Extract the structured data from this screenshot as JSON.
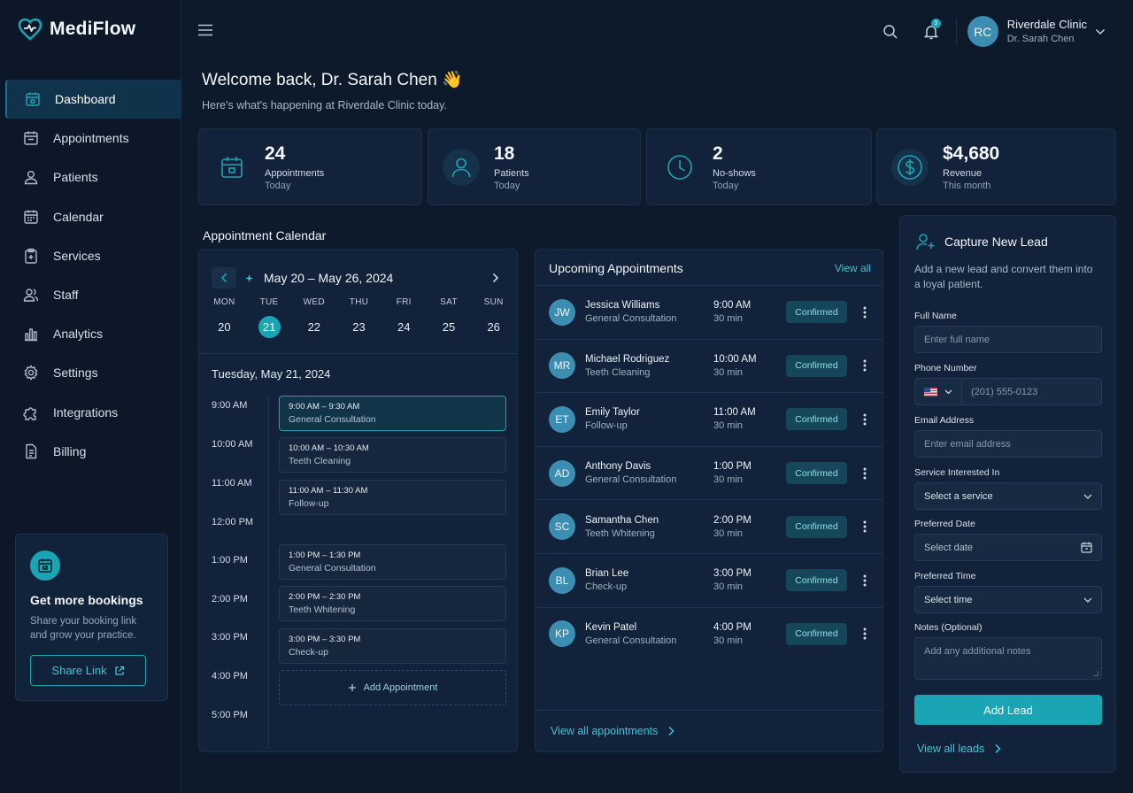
{
  "app": {
    "name": "MediFlow"
  },
  "sidebar": {
    "items": [
      {
        "label": "Dashboard",
        "icon": "dashboard-icon",
        "active": true
      },
      {
        "label": "Appointments",
        "icon": "appointments-icon"
      },
      {
        "label": "Patients",
        "icon": "patients-icon"
      },
      {
        "label": "Calendar",
        "icon": "calendar-icon"
      },
      {
        "label": "Services",
        "icon": "services-icon"
      },
      {
        "label": "Staff",
        "icon": "staff-icon"
      },
      {
        "label": "Analytics",
        "icon": "analytics-icon"
      },
      {
        "label": "Settings",
        "icon": "settings-icon"
      },
      {
        "label": "Integrations",
        "icon": "integrations-icon"
      },
      {
        "label": "Billing",
        "icon": "billing-icon"
      }
    ],
    "promo": {
      "title": "Get more bookings",
      "text": "Share your booking link and grow your practice.",
      "button": "Share Link"
    }
  },
  "header": {
    "notification_count": "3",
    "user": {
      "initials": "RC",
      "org": "Riverdale Clinic",
      "name": "Dr. Sarah Chen"
    }
  },
  "welcome": {
    "title": "Welcome back, Dr. Sarah Chen 👋",
    "subtitle": "Here's what's happening at Riverdale Clinic today."
  },
  "stats": [
    {
      "value": "24",
      "label": "Appointments",
      "sub": "Today",
      "icon": "calendar-icon"
    },
    {
      "value": "18",
      "label": "Patients",
      "sub": "Today",
      "icon": "user-icon"
    },
    {
      "value": "2",
      "label": "No-shows",
      "sub": "Today",
      "icon": "clock-icon"
    },
    {
      "value": "$4,680",
      "label": "Revenue",
      "sub": "This month",
      "icon": "dollar-icon"
    }
  ],
  "calendar": {
    "section_title": "Appointment Calendar",
    "range": "May 20 – May 26, 2024",
    "days": [
      {
        "name": "MON",
        "num": "20"
      },
      {
        "name": "TUE",
        "num": "21",
        "selected": true
      },
      {
        "name": "WED",
        "num": "22"
      },
      {
        "name": "THU",
        "num": "23"
      },
      {
        "name": "FRI",
        "num": "24"
      },
      {
        "name": "SAT",
        "num": "25"
      },
      {
        "name": "SUN",
        "num": "26"
      }
    ],
    "day_title": "Tuesday, May 21, 2024",
    "times": [
      "9:00 AM",
      "10:00 AM",
      "11:00 AM",
      "12:00 PM",
      "1:00 PM",
      "2:00 PM",
      "3:00 PM",
      "4:00 PM",
      "5:00 PM"
    ],
    "slots": [
      {
        "time": "9:00 AM – 9:30 AM",
        "type": "General Consultation"
      },
      {
        "time": "10:00 AM – 10:30 AM",
        "type": "Teeth Cleaning"
      },
      {
        "time": "11:00 AM – 11:30 AM",
        "type": "Follow-up"
      },
      {
        "time": "1:00 PM – 1:30 PM",
        "type": "General Consultation"
      },
      {
        "time": "2:00 PM – 2:30 PM",
        "type": "Teeth Whitening"
      },
      {
        "time": "3:00 PM – 3:30 PM",
        "type": "Check-up"
      }
    ],
    "add_label": "Add Appointment"
  },
  "upcoming": {
    "title": "Upcoming Appointments",
    "view_all": "View all",
    "footer": "View all appointments",
    "items": [
      {
        "initials": "JW",
        "name": "Jessica Williams",
        "type": "General Consultation",
        "time": "9:00 AM",
        "duration": "30 min",
        "status": "Confirmed"
      },
      {
        "initials": "MR",
        "name": "Michael Rodriguez",
        "type": "Teeth Cleaning",
        "time": "10:00 AM",
        "duration": "30 min",
        "status": "Confirmed"
      },
      {
        "initials": "ET",
        "name": "Emily Taylor",
        "type": "Follow-up",
        "time": "11:00 AM",
        "duration": "30 min",
        "status": "Confirmed"
      },
      {
        "initials": "AD",
        "name": "Anthony Davis",
        "type": "General Consultation",
        "time": "1:00 PM",
        "duration": "30 min",
        "status": "Confirmed"
      },
      {
        "initials": "SC",
        "name": "Samantha Chen",
        "type": "Teeth Whitening",
        "time": "2:00 PM",
        "duration": "30 min",
        "status": "Confirmed"
      },
      {
        "initials": "BL",
        "name": "Brian Lee",
        "type": "Check-up",
        "time": "3:00 PM",
        "duration": "30 min",
        "status": "Confirmed"
      },
      {
        "initials": "KP",
        "name": "Kevin Patel",
        "type": "General Consultation",
        "time": "4:00 PM",
        "duration": "30 min",
        "status": "Confirmed"
      }
    ]
  },
  "lead": {
    "title": "Capture New Lead",
    "desc": "Add a new lead and convert them into a loyal patient.",
    "full_name_label": "Full Name",
    "full_name_placeholder": "Enter full name",
    "phone_label": "Phone Number",
    "phone_placeholder": "(201) 555-0123",
    "email_label": "Email Address",
    "email_placeholder": "Enter email address",
    "service_label": "Service Interested In",
    "service_value": "Select a service",
    "date_label": "Preferred Date",
    "date_value": "Select date",
    "time_label": "Preferred Time",
    "time_value": "Select time",
    "notes_label": "Notes (Optional)",
    "notes_placeholder": "Add any additional notes",
    "submit": "Add Lead",
    "footer": "View all leads"
  },
  "colors": {
    "accent": "#1aa5b5",
    "background": "#0d1a2b",
    "card": "#11223a"
  }
}
